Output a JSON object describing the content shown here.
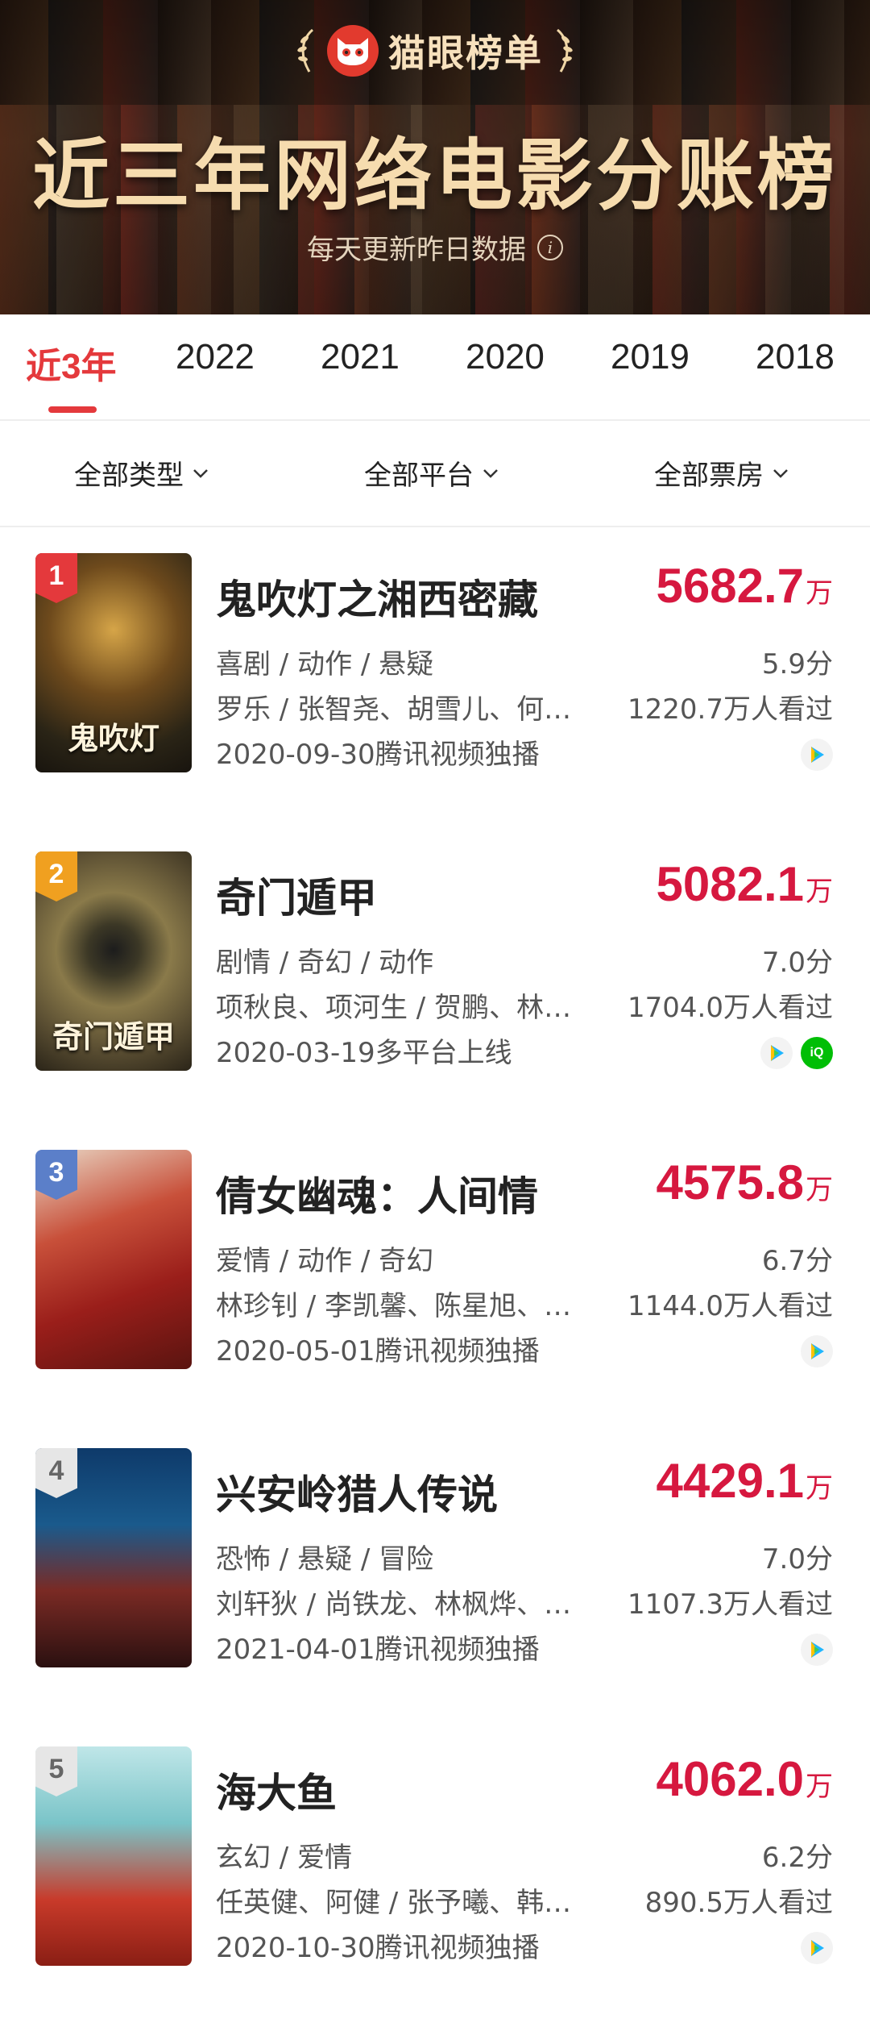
{
  "header": {
    "brand_name": "猫眼榜单",
    "title": "近三年网络电影分账榜",
    "subtitle": "每天更新昨日数据",
    "accent": "#e4393c"
  },
  "tabs": [
    {
      "label": "近3年",
      "active": true
    },
    {
      "label": "2022"
    },
    {
      "label": "2021"
    },
    {
      "label": "2020"
    },
    {
      "label": "2019"
    },
    {
      "label": "2018"
    }
  ],
  "filters": [
    {
      "label": "全部类型"
    },
    {
      "label": "全部平台"
    },
    {
      "label": "全部票房"
    }
  ],
  "movies": [
    {
      "rank": "1",
      "title": "鬼吹灯之湘西密藏",
      "box_office": "5682.7",
      "unit": "万",
      "genres": "喜剧 / 动作 / 悬疑",
      "score": "5.9分",
      "cast": "罗乐 / 张智尧、胡雪儿、何…",
      "viewers": "1220.7万人看过",
      "release": "2020-09-30腾讯视频独播",
      "poster_text": "鬼吹灯",
      "platforms": [
        "tencent-video-icon"
      ]
    },
    {
      "rank": "2",
      "title": "奇门遁甲",
      "box_office": "5082.1",
      "unit": "万",
      "genres": "剧情 / 奇幻 / 动作",
      "score": "7.0分",
      "cast": "项秋良、项河生 / 贺鹏、林…",
      "viewers": "1704.0万人看过",
      "release": "2020-03-19多平台上线",
      "poster_text": "奇门遁甲",
      "platforms": [
        "tencent-video-icon",
        "iqiyi-icon"
      ]
    },
    {
      "rank": "3",
      "title": "倩女幽魂：人间情",
      "box_office": "4575.8",
      "unit": "万",
      "genres": "爱情 / 动作 / 奇幻",
      "score": "6.7分",
      "cast": "林珍钊 / 李凯馨、陈星旭、…",
      "viewers": "1144.0万人看过",
      "release": "2020-05-01腾讯视频独播",
      "poster_text": "",
      "platforms": [
        "tencent-video-icon"
      ]
    },
    {
      "rank": "4",
      "title": "兴安岭猎人传说",
      "box_office": "4429.1",
      "unit": "万",
      "genres": "恐怖 / 悬疑 / 冒险",
      "score": "7.0分",
      "cast": "刘轩狄 / 尚铁龙、林枫烨、…",
      "viewers": "1107.3万人看过",
      "release": "2021-04-01腾讯视频独播",
      "poster_text": "",
      "platforms": [
        "tencent-video-icon"
      ]
    },
    {
      "rank": "5",
      "title": "海大鱼",
      "box_office": "4062.0",
      "unit": "万",
      "genres": "玄幻 / 爱情",
      "score": "6.2分",
      "cast": "任英健、阿健 / 张予曦、韩栋…",
      "viewers": "890.5万人看过",
      "release": "2020-10-30腾讯视频独播",
      "poster_text": "",
      "platforms": [
        "tencent-video-icon"
      ]
    }
  ]
}
